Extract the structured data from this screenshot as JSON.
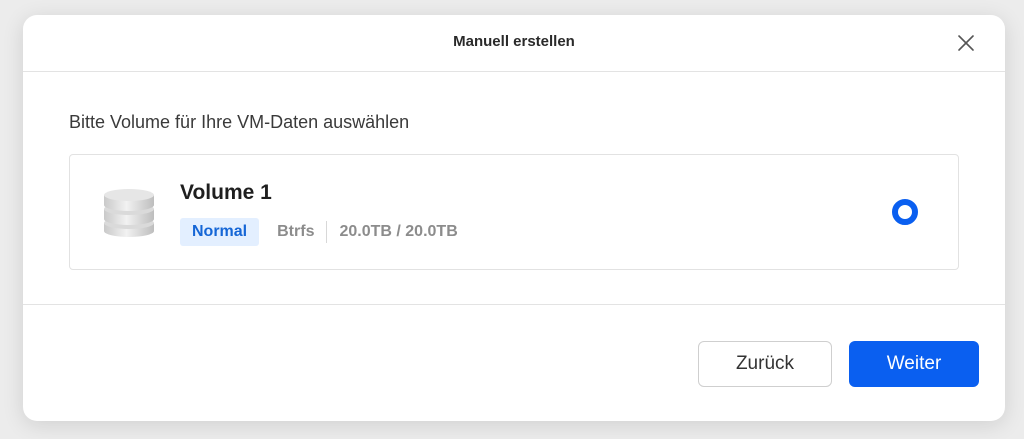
{
  "dialog": {
    "title": "Manuell erstellen",
    "close_icon": "close-icon"
  },
  "body": {
    "instruction": "Bitte Volume für Ihre VM-Daten auswählen",
    "volume": {
      "icon": "database-icon",
      "name": "Volume 1",
      "status": "Normal",
      "filesystem": "Btrfs",
      "capacity": "20.0TB / 20.0TB",
      "selected": true
    }
  },
  "footer": {
    "back_label": "Zurück",
    "next_label": "Weiter"
  },
  "colors": {
    "accent": "#0a5ff0",
    "badge_bg": "#e3efff",
    "badge_text": "#1566d6"
  }
}
